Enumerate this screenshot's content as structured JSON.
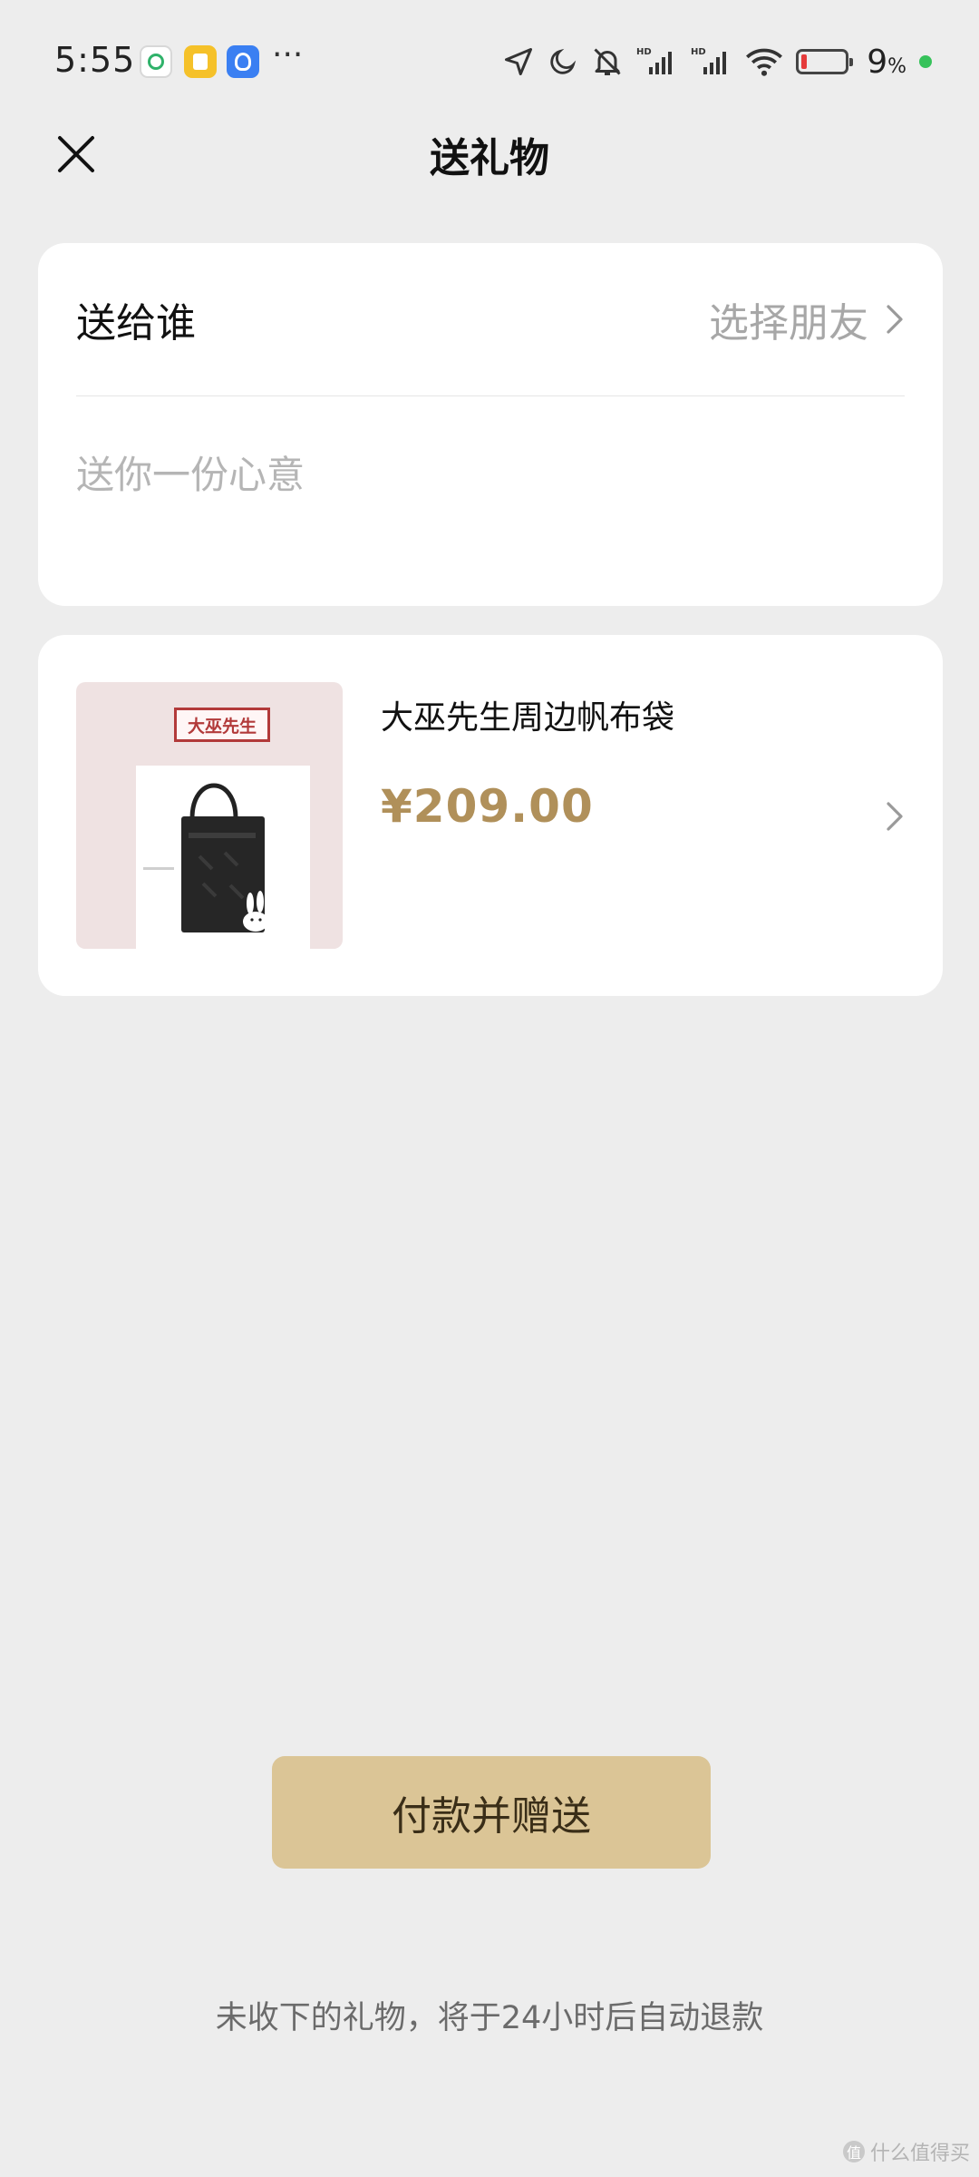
{
  "status_bar": {
    "time": "5:55",
    "battery_percent": "9",
    "battery_unit": "%",
    "notification_apps": [
      "sync-app-icon",
      "clipboard-app-icon",
      "alarm-app-icon"
    ],
    "more_indicator": "···",
    "signal_label_1": "HD",
    "signal_label_2": "HD",
    "icons": [
      "location-icon",
      "moon-icon",
      "bell-muted-icon",
      "signal-icon",
      "signal-icon",
      "wifi-icon",
      "battery-icon"
    ],
    "colors": {
      "battery_low": "#e53b3b",
      "charging_dot": "#36c25a"
    }
  },
  "nav": {
    "title": "送礼物",
    "close_icon": "close-icon"
  },
  "recipient": {
    "label": "送给谁",
    "select_text": "选择朋友",
    "message_placeholder": "送你一份心意",
    "message_value": ""
  },
  "product": {
    "image_brand_text": "大巫先生",
    "name": "大巫先生周边帆布袋",
    "price": "¥209.00"
  },
  "actions": {
    "pay_label": "付款并赠送",
    "refund_note": "未收下的礼物，将于24小时后自动退款"
  },
  "watermark": {
    "badge": "值",
    "text": "什么值得买"
  },
  "colors": {
    "background": "#ededed",
    "accent_price": "#b0905a",
    "pay_button": "#dbc596"
  }
}
